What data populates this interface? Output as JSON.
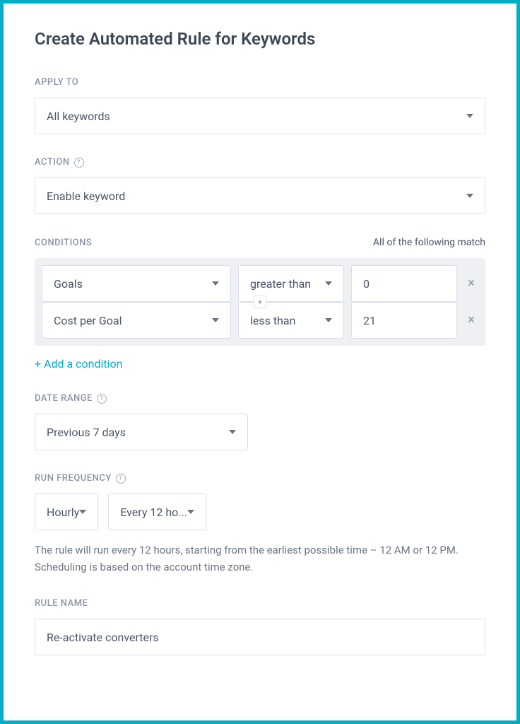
{
  "title": "Create Automated Rule for Keywords",
  "apply_to": {
    "label": "APPLY TO",
    "value": "All keywords"
  },
  "action": {
    "label": "ACTION",
    "value": "Enable keyword"
  },
  "conditions": {
    "label": "CONDITIONS",
    "note": "All of the following match",
    "rows": [
      {
        "metric": "Goals",
        "operator": "greater than",
        "value": "0"
      },
      {
        "metric": "Cost per Goal",
        "operator": "less than",
        "value": "21"
      }
    ],
    "add_link": "+ Add a condition"
  },
  "date_range": {
    "label": "DATE RANGE",
    "value": "Previous 7 days"
  },
  "run_frequency": {
    "label": "RUN FREQUENCY",
    "unit": "Hourly",
    "interval": "Every 12 ho...",
    "note": "The rule will run every 12 hours, starting from the earliest possible time – 12 AM or 12 PM. Scheduling is based on the account time zone."
  },
  "rule_name": {
    "label": "RULE NAME",
    "value": "Re-activate converters"
  }
}
